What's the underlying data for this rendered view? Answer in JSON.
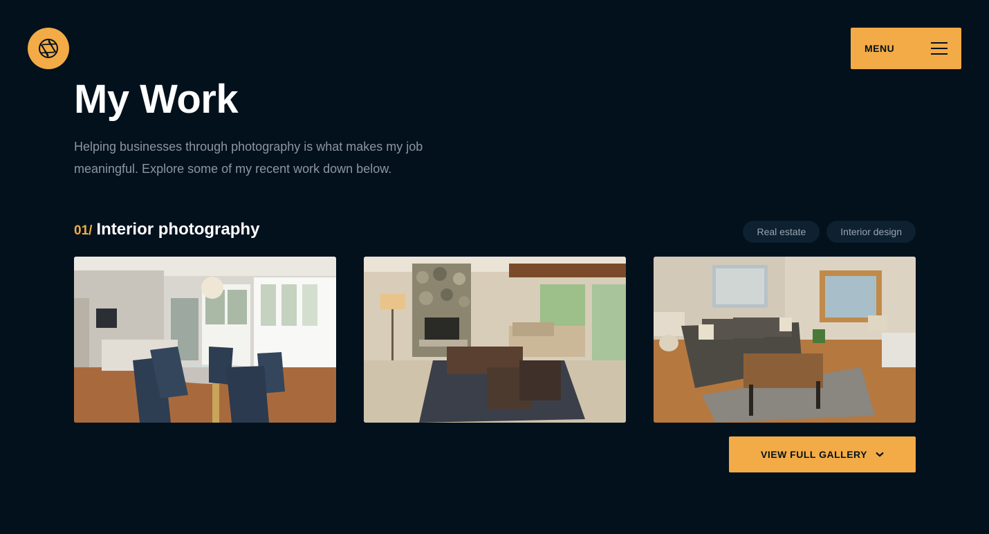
{
  "header": {
    "logo_icon": "camera-aperture-icon",
    "menu_label": "MENU",
    "menu_icon": "hamburger-icon"
  },
  "hero": {
    "title": "My Work",
    "intro": "Helping businesses through photography is what makes my job meaningful. Explore some of my recent work down below."
  },
  "section": {
    "number": "01/",
    "title": "Interior photography",
    "tags": [
      "Real estate",
      "Interior design"
    ],
    "photos": [
      {
        "subject": "dining-room-photo"
      },
      {
        "subject": "stone-fireplace-living-room-photo"
      },
      {
        "subject": "sunlit-living-room-photo"
      }
    ]
  },
  "gallery_button": {
    "label": "VIEW FULL GALLERY",
    "icon": "chevron-down-icon"
  },
  "colors": {
    "background": "#03111d",
    "accent": "#f2ab46",
    "tag_bg": "#0d2130",
    "muted_text": "#8c96a0"
  }
}
